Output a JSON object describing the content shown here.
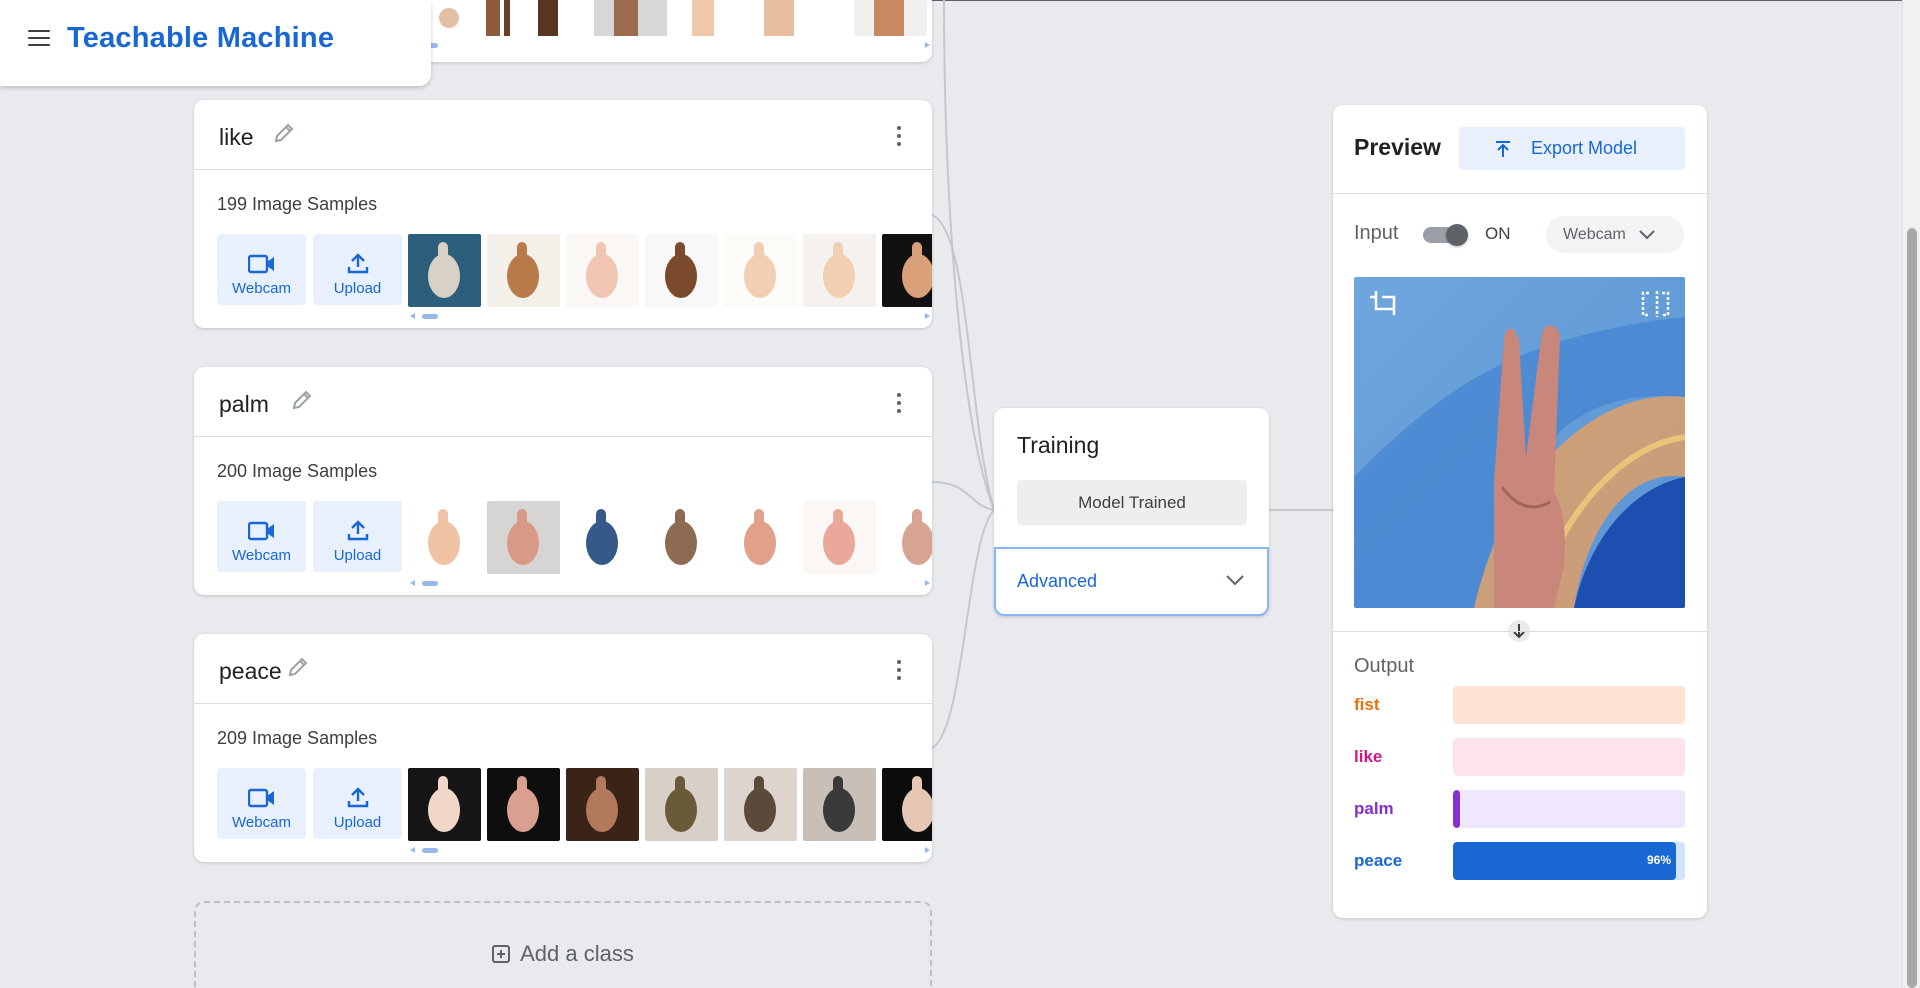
{
  "app": {
    "title": "Teachable Machine"
  },
  "classes": [
    {
      "name": "like",
      "samples": "199 Image Samples"
    },
    {
      "name": "palm",
      "samples": "200 Image Samples"
    },
    {
      "name": "peace",
      "samples": "209 Image Samples"
    }
  ],
  "buttons": {
    "webcam": "Webcam",
    "upload": "Upload"
  },
  "add_class": "Add a class",
  "training": {
    "title": "Training",
    "status": "Model Trained",
    "advanced": "Advanced"
  },
  "preview": {
    "title": "Preview",
    "export": "Export Model",
    "input_label": "Input",
    "toggle_state": "ON",
    "source": "Webcam",
    "output_label": "Output",
    "outputs": [
      {
        "name": "fist",
        "value": 0.0,
        "color": "#e8710a",
        "bg": "#fde3d4",
        "percent": ""
      },
      {
        "name": "like",
        "value": 0.0,
        "color": "#d01884",
        "bg": "#fce4ea",
        "percent": ""
      },
      {
        "name": "palm",
        "value": 0.03,
        "color": "#8430ce",
        "bg": "#efe8fd",
        "percent": ""
      },
      {
        "name": "peace",
        "value": 0.96,
        "color": "#1967d2",
        "bg": "#d2e3fc",
        "percent": "96%"
      }
    ]
  },
  "colors": {
    "accent": "#1967d2",
    "button_bg": "#e8f0fe",
    "page_bg": "#e8eaed"
  }
}
